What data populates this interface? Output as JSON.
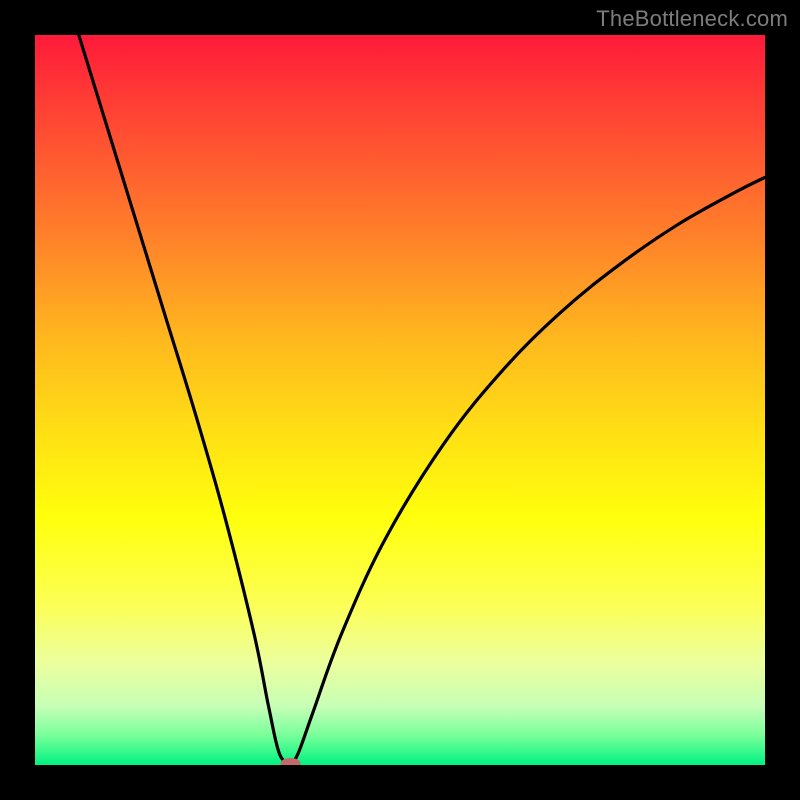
{
  "watermark": "TheBottleneck.com",
  "chart_data": {
    "type": "line",
    "title": "",
    "xlabel": "",
    "ylabel": "",
    "xlim": [
      0,
      100
    ],
    "ylim": [
      0,
      100
    ],
    "series": [
      {
        "name": "bottleneck-curve",
        "x": [
          6,
          10,
          14,
          18,
          22,
          26,
          30,
          32,
          33.5,
          35,
          36,
          38,
          42,
          48,
          56,
          64,
          72,
          80,
          88,
          96,
          100
        ],
        "y": [
          100,
          87,
          74,
          61,
          48,
          34,
          18,
          8,
          1.5,
          0.5,
          1.5,
          7,
          18,
          31,
          44,
          54,
          62,
          68.5,
          74,
          78.5,
          80.5
        ]
      }
    ],
    "marker": {
      "name": "optimal-marker",
      "x": 35,
      "y": 0,
      "color": "#c36a6a",
      "rx": 10,
      "ry": 5
    },
    "gradient_stops": [
      {
        "pos": 0,
        "color": "#ff1a3a"
      },
      {
        "pos": 8,
        "color": "#ff3935"
      },
      {
        "pos": 18,
        "color": "#ff5e30"
      },
      {
        "pos": 30,
        "color": "#ff8a28"
      },
      {
        "pos": 42,
        "color": "#ffb91e"
      },
      {
        "pos": 55,
        "color": "#ffe114"
      },
      {
        "pos": 66,
        "color": "#ffff0c"
      },
      {
        "pos": 78,
        "color": "#fcff55"
      },
      {
        "pos": 86,
        "color": "#ecff9e"
      },
      {
        "pos": 92,
        "color": "#c6ffb6"
      },
      {
        "pos": 96,
        "color": "#77ff9a"
      },
      {
        "pos": 100,
        "color": "#00f281"
      }
    ]
  }
}
